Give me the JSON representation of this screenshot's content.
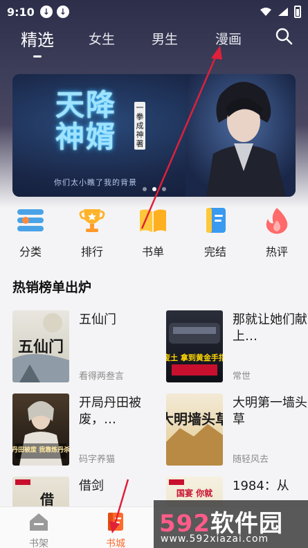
{
  "status_bar": {
    "time": "9:10"
  },
  "top_nav": {
    "tabs": [
      {
        "label": "精选",
        "active": true
      },
      {
        "label": "女生",
        "active": false
      },
      {
        "label": "男生",
        "active": false
      },
      {
        "label": "漫画",
        "active": false
      }
    ]
  },
  "banner": {
    "title": "天降神婿",
    "vertical_text": "一拳成神著",
    "subtitle": "你们太小瞧了我的背景",
    "dots": 3,
    "active_dot": 1
  },
  "quick_menu": [
    {
      "label": "分类",
      "icon": "category-icon"
    },
    {
      "label": "排行",
      "icon": "trophy-icon"
    },
    {
      "label": "书单",
      "icon": "book-list-icon"
    },
    {
      "label": "完结",
      "icon": "finished-book-icon"
    },
    {
      "label": "热评",
      "icon": "hot-comment-icon"
    }
  ],
  "section": {
    "title": "热销榜单出炉"
  },
  "books": [
    {
      "title": "五仙门",
      "author": "看得两叁言",
      "cover_text": "五仙门"
    },
    {
      "title": "那就让她们献上…",
      "author": "常世",
      "cover_text": "纨绔废土 拿到黄金手指开始"
    },
    {
      "title": "开局丹田被废，…",
      "author": "码字养猫",
      "cover_text": "开局丹田被废 我靠炼丹杀疯了"
    },
    {
      "title": "大明第一墙头草",
      "author": "随轻风去",
      "cover_text": "大明墙头草"
    },
    {
      "title": "借剑",
      "author": "",
      "cover_text": "借"
    },
    {
      "title": "1984：从",
      "author": "",
      "cover_text": "国宴 你就"
    }
  ],
  "bottom_nav": [
    {
      "label": "书架",
      "active": false
    },
    {
      "label": "书城",
      "active": true
    }
  ],
  "watermark": {
    "main_prefix": "592",
    "main_suffix": "软件园",
    "url": "www.592xiazai.com"
  },
  "colors": {
    "accent": "#ff6a2b",
    "header_bg": "#2d2f4a",
    "arrow": "#e0203a"
  }
}
